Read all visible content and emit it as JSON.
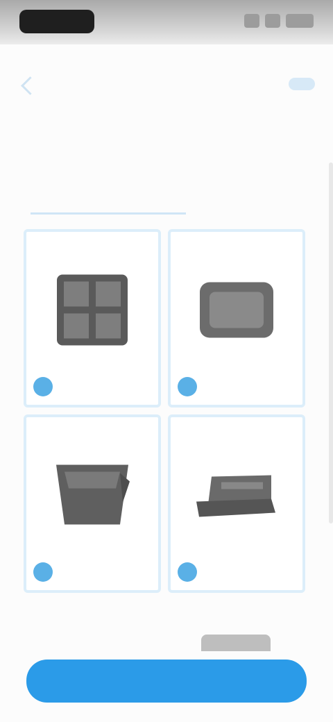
{
  "status_bar": {
    "time": ""
  },
  "header": {
    "help_label": ""
  },
  "main": {
    "title": "",
    "section_label": "",
    "options": [
      {
        "label": "",
        "icon": "grid-device-icon"
      },
      {
        "label": "",
        "icon": "box-device-icon"
      },
      {
        "label": "",
        "icon": "basket-device-icon"
      },
      {
        "label": "",
        "icon": "flat-device-icon"
      }
    ]
  },
  "footer": {
    "primary_button_label": ""
  },
  "colors": {
    "accent": "#2b9be8",
    "tile_border": "#dceefa",
    "background": "#fcfcfc"
  }
}
